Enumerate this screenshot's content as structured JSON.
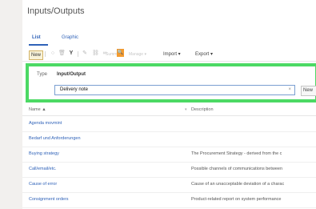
{
  "page": {
    "title": "Inputs/Outputs"
  },
  "tabs": [
    {
      "label": "List",
      "active": true
    },
    {
      "label": "Graphic",
      "active": false
    }
  ],
  "toolbar": {
    "new_label": "New",
    "import_label": "Import ▾",
    "export_label": "Export ▾",
    "disabled_labels": [
      "Summary",
      "Manage ▾"
    ],
    "icons": [
      "circle-icon",
      "trash-icon",
      "filter-icon",
      "edit-icon",
      "link-icon",
      "unlink-icon"
    ]
  },
  "filter": {
    "type_label": "Type",
    "type_value": "Input/Output",
    "search_value": "Delivery note",
    "clear_symbol": "×",
    "new_label": "New"
  },
  "table": {
    "columns": [
      {
        "label": "Name ▲"
      },
      {
        "label": "Description"
      }
    ],
    "rows": [
      {
        "name": "Agenda movmint",
        "description": ""
      },
      {
        "name": "Bedarf und Anforderungen",
        "description": ""
      },
      {
        "name": "Buying strategy",
        "description": "The Procurement Strategy - derived from the c"
      },
      {
        "name": "Call/email/etc.",
        "description": "Possible channels of communications between"
      },
      {
        "name": "Cause of error",
        "description": "Cause of an unacceptable deviation of a charac"
      },
      {
        "name": "Consignment orders",
        "description": "Product-related report on system performance"
      }
    ]
  },
  "colors": {
    "accent": "#2f62b8",
    "highlight_border": "#4cd964",
    "search_button": "#f39b2f"
  }
}
